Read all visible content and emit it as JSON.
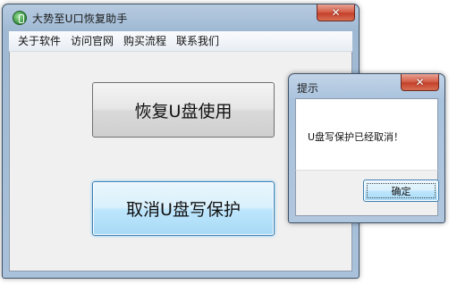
{
  "main_window": {
    "title": "大势至U口恢复助手",
    "close_label": "✕"
  },
  "menu": {
    "items": [
      {
        "label": "关于软件"
      },
      {
        "label": "访问官网"
      },
      {
        "label": "购买流程"
      },
      {
        "label": "联系我们"
      }
    ]
  },
  "buttons": {
    "restore_label": "恢复U盘使用",
    "cancel_protect_label": "取消U盘写保护"
  },
  "dialog": {
    "title": "提示",
    "close_label": "✕",
    "message": "U盘写保护已经取消！",
    "ok_label": "确定"
  },
  "icons": {
    "app": "usb-recovery-icon",
    "close": "close-icon"
  },
  "colors": {
    "close_button": "#c4402b",
    "focus_button": "#bee6fd"
  }
}
